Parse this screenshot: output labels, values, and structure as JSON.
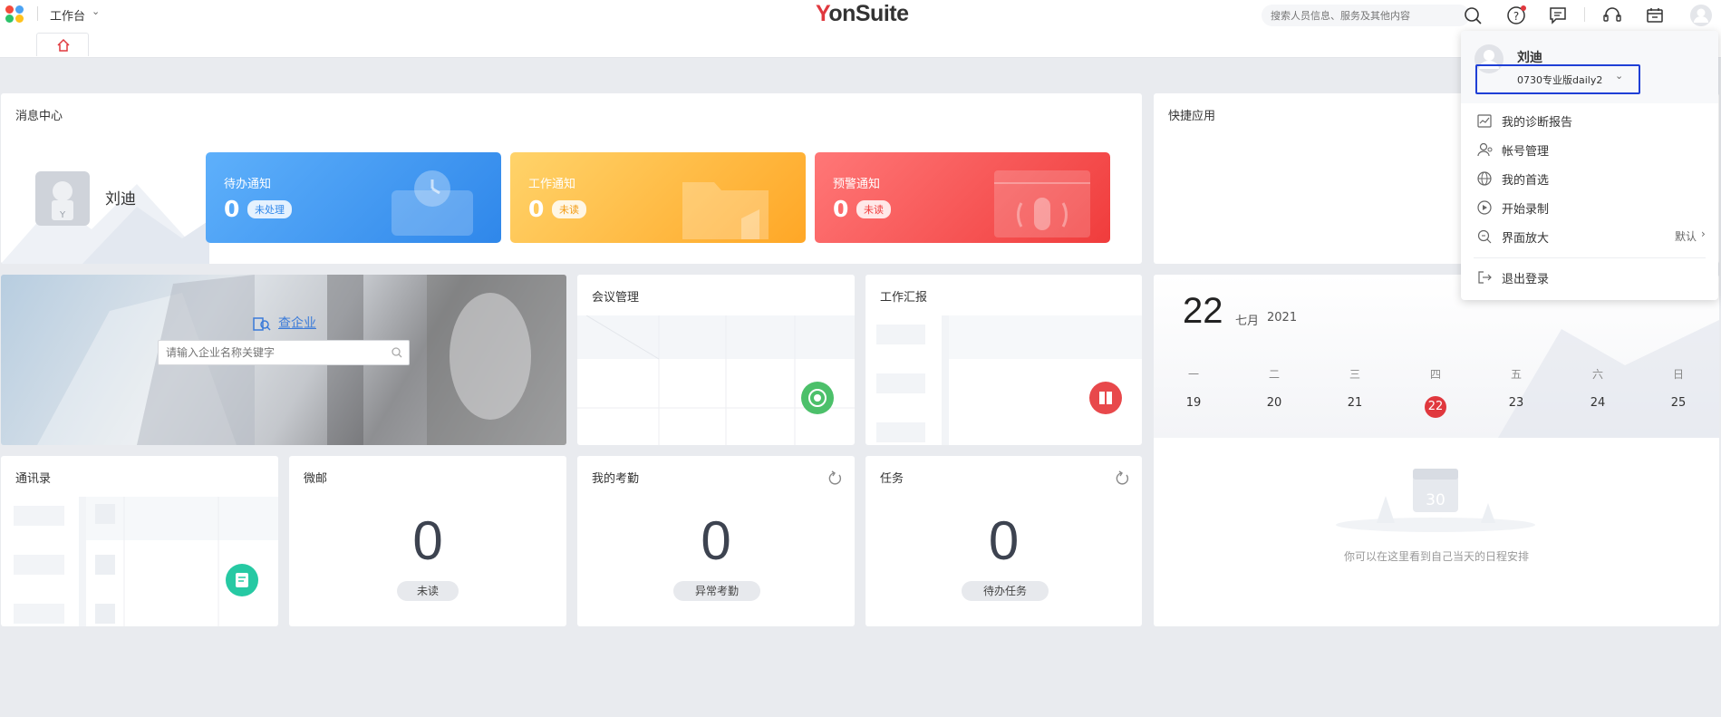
{
  "header": {
    "workbench_label": "工作台",
    "brand": "YonSuite",
    "search_placeholder": "搜索人员信息、服务及其他内容"
  },
  "message_center": {
    "title": "消息中心",
    "user_name": "刘迪",
    "cards": [
      {
        "title": "待办通知",
        "count": "0",
        "badge": "未处理",
        "color": "#3c93f0"
      },
      {
        "title": "工作通知",
        "count": "0",
        "badge": "未读",
        "color": "#ffb838"
      },
      {
        "title": "预警通知",
        "count": "0",
        "badge": "未读",
        "color": "#f24b4b"
      }
    ]
  },
  "quick_apps": {
    "title": "快捷应用"
  },
  "enterprise": {
    "link_label": "查企业",
    "search_placeholder": "请输入企业名称关键字"
  },
  "meeting": {
    "title": "会议管理"
  },
  "work_report": {
    "title": "工作汇报"
  },
  "contacts": {
    "title": "通讯录"
  },
  "mail": {
    "title": "微邮",
    "count": "0",
    "label": "未读"
  },
  "attendance": {
    "title": "我的考勤",
    "count": "0",
    "label": "异常考勤"
  },
  "tasks": {
    "title": "任务",
    "count": "0",
    "label": "待办任务"
  },
  "calendar": {
    "day": "22",
    "month": "七月",
    "year": "2021",
    "weekdays": [
      "一",
      "二",
      "三",
      "四",
      "五",
      "六",
      "日"
    ],
    "dates": [
      "19",
      "20",
      "21",
      "22",
      "23",
      "24",
      "25"
    ],
    "today_index": 3,
    "empty_icon_number": "30",
    "empty_text": "你可以在这里看到自己当天的日程安排"
  },
  "user_menu": {
    "name": "刘迪",
    "tenant": "0730专业版daily2",
    "items": [
      {
        "label": "我的诊断报告",
        "icon": "report-icon"
      },
      {
        "label": "帐号管理",
        "icon": "account-icon"
      },
      {
        "label": "我的首选",
        "icon": "globe-icon"
      },
      {
        "label": "开始录制",
        "icon": "record-icon"
      },
      {
        "label": "界面放大",
        "icon": "zoom-icon",
        "value": "默认"
      }
    ],
    "logout_label": "退出登录"
  },
  "colors": {
    "accent_red": "#e0383e",
    "highlight_border": "#1f3fd6"
  }
}
